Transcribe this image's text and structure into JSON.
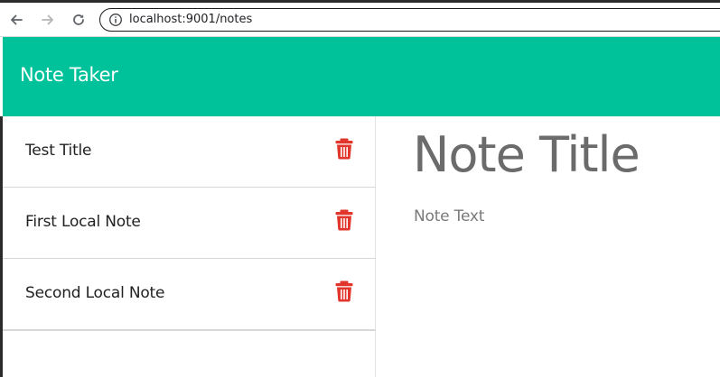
{
  "browser": {
    "url": "localhost:9001/notes",
    "back_icon": "arrow-left-icon",
    "forward_icon": "arrow-right-icon",
    "reload_icon": "reload-icon",
    "site_info_icon": "info-icon"
  },
  "app": {
    "title": "Note Taker",
    "header_color": "#00c29a"
  },
  "notes": [
    {
      "title": "Test Title",
      "delete_icon": "trash-icon"
    },
    {
      "title": "First Local Note",
      "delete_icon": "trash-icon"
    },
    {
      "title": "Second Local Note",
      "delete_icon": "trash-icon"
    }
  ],
  "editor": {
    "title_placeholder": "Note Title",
    "text_placeholder": "Note Text"
  },
  "colors": {
    "accent": "#00c29a",
    "delete": "#e2362c"
  }
}
